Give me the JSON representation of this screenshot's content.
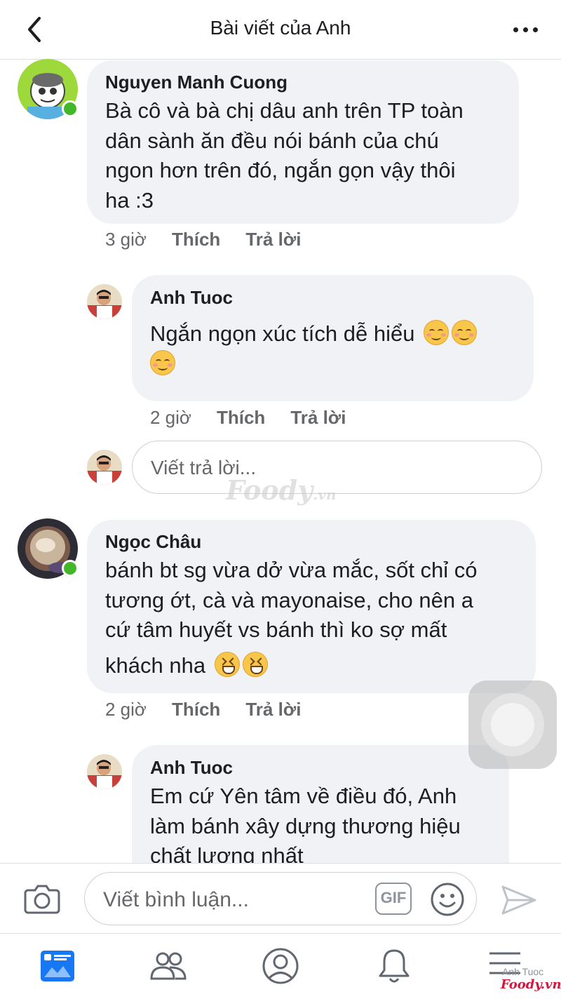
{
  "header": {
    "title": "Bài viết của Anh"
  },
  "comments": [
    {
      "author": "Nguyen Manh Cuong",
      "lines": [
        "Bà cô và bà chị dâu anh trên TP toàn",
        "dân sành ăn đều nói bánh của chú",
        "ngon hơn trên đó, ngắn gọn vậy thôi",
        "ha :3"
      ],
      "time": "3 giờ",
      "like": "Thích",
      "reply": "Trả lời"
    },
    {
      "author": "Anh Tuoc",
      "lines": [
        "Ngắn ngọn xúc tích dễ hiểu"
      ],
      "time": "2 giờ",
      "like": "Thích",
      "reply": "Trả lời"
    },
    {
      "author": "Ngọc Châu",
      "lines": [
        "bánh bt sg vừa dở vừa mắc, sốt chỉ có",
        "tương ớt, cà và mayonaise, cho nên a",
        "cứ tâm huyết vs bánh thì ko sợ mất",
        "khách nha"
      ],
      "time": "2 giờ",
      "like": "Thích",
      "reply": "Trả lời"
    },
    {
      "author": "Anh Tuoc",
      "lines": [
        "Em cứ Yên tâm về điều đó, Anh",
        "làm bánh xây dựng thương hiệu",
        "chất lượng nhất"
      ]
    }
  ],
  "reply_input": {
    "placeholder": "Viết trả lời..."
  },
  "watermark": {
    "brand": "Foody",
    "suffix": ".vn"
  },
  "composer": {
    "placeholder": "Viết bình luận...",
    "gif_label": "GIF"
  },
  "nav_credit": {
    "name": "Anh Tuoc",
    "brand": "Foody.vn"
  },
  "colors": {
    "online": "#42b72a",
    "bubble": "#f0f2f5",
    "nav_active": "#1877f2"
  }
}
